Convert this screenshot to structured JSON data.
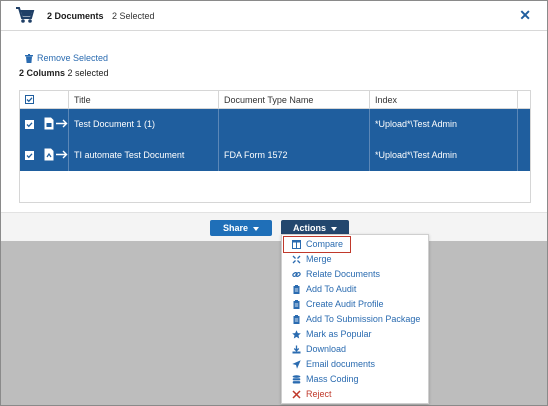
{
  "header": {
    "documents_label": "2 Documents",
    "selected_label": "2 Selected"
  },
  "toolbar": {
    "remove_selected": "Remove Selected"
  },
  "summary": {
    "columns_count": "2 Columns",
    "columns_selected": "2 selected"
  },
  "table": {
    "columns": [
      "Title",
      "Document Type Name",
      "Index"
    ],
    "rows": [
      {
        "title": "Test Document 1 (1)",
        "doc_type": "",
        "index": "*Upload*\\Test Admin",
        "checked": true
      },
      {
        "title": "TI automate Test Document",
        "doc_type": "FDA Form 1572",
        "index": "*Upload*\\Test Admin",
        "checked": true
      }
    ]
  },
  "footer": {
    "share_label": "Share",
    "actions_label": "Actions"
  },
  "actions_menu": {
    "items": [
      {
        "label": "Compare",
        "icon": "columns-icon",
        "selected": true
      },
      {
        "label": "Merge",
        "icon": "merge-arrows-icon"
      },
      {
        "label": "Relate Documents",
        "icon": "link-icon"
      },
      {
        "label": "Add To Audit",
        "icon": "clipboard-icon"
      },
      {
        "label": "Create Audit Profile",
        "icon": "clipboard-icon"
      },
      {
        "label": "Add To Submission Package",
        "icon": "clipboard-icon"
      },
      {
        "label": "Mark as Popular",
        "icon": "star-icon"
      },
      {
        "label": "Download",
        "icon": "download-icon"
      },
      {
        "label": "Email documents",
        "icon": "send-icon"
      },
      {
        "label": "Mass Coding",
        "icon": "database-icon"
      },
      {
        "label": "Reject",
        "icon": "close-icon",
        "color": "#c0392b"
      }
    ]
  },
  "colors": {
    "primary": "#1f5e9e",
    "link": "#2a6bb0",
    "actions_button": "#23476e",
    "share_button": "#1f6fb8",
    "danger": "#c0392b",
    "backdrop": "#bdbdbd"
  }
}
